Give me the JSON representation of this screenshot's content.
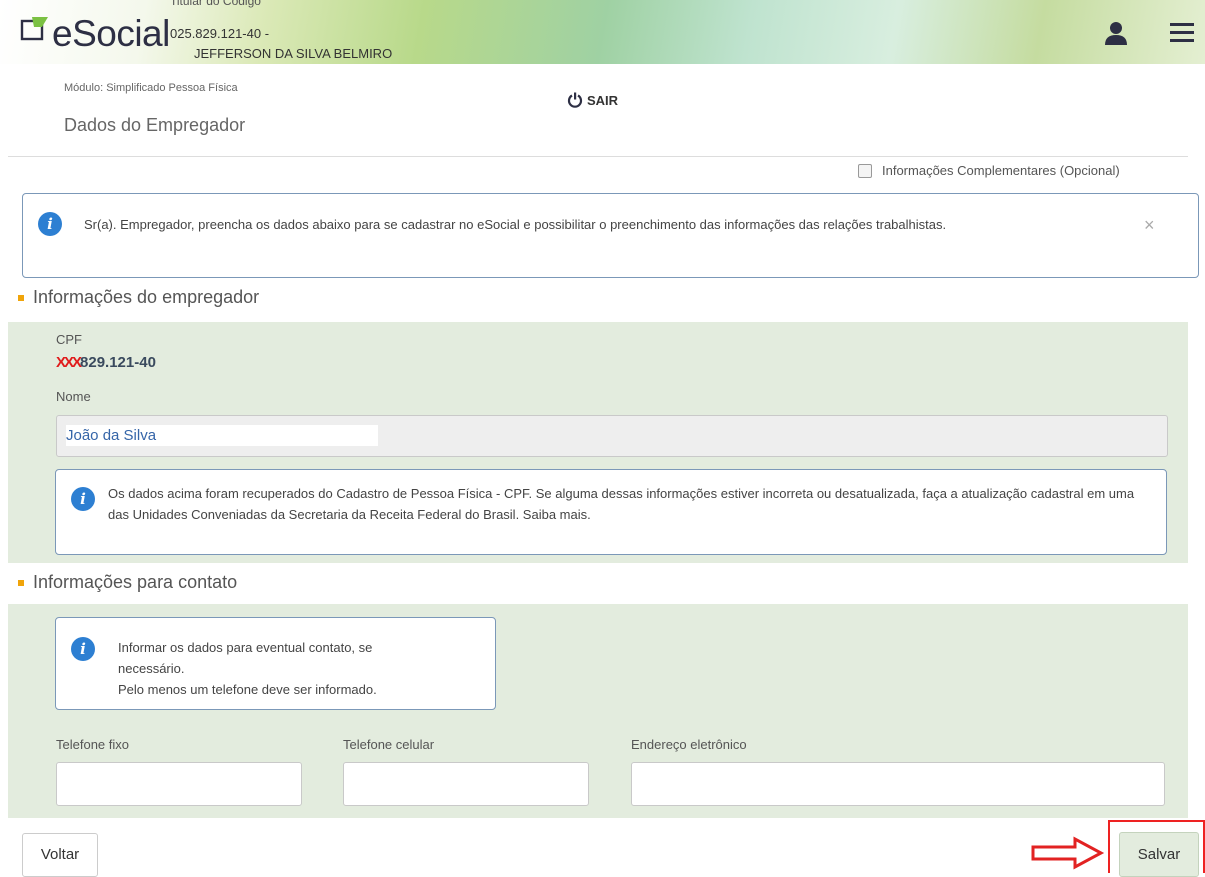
{
  "header": {
    "logo_text": "eSocial",
    "top_text": "Titular do Código",
    "cpf_line": "025.829.121-40 -",
    "name_line": "JEFFERSON DA SILVA BELMIRO",
    "icons": [
      "user-icon",
      "menu-icon"
    ]
  },
  "page": {
    "module": "Módulo: Simplificado Pessoa Física",
    "sair": "SAIR",
    "title": "Dados do Empregador",
    "complementares": "Informações Complementares (Opcional)"
  },
  "alert": {
    "text": "Sr(a). Empregador, preencha os dados abaixo para se cadastrar no eSocial e possibilitar o preenchimento das informações das relações trabalhistas.",
    "close": "×"
  },
  "empregador": {
    "section_title": "Informações do empregador",
    "cpf_label": "CPF",
    "cpf_masked": "XXX",
    "cpf_value": "829.121-40",
    "nome_label": "Nome",
    "nome_value": "João da Silva",
    "info": "Os dados acima foram recuperados do Cadastro de Pessoa Física - CPF. Se alguma dessas informações estiver incorreta ou desatualizada, faça a atualização cadastral em uma das Unidades Conveniadas da Secretaria da Receita Federal do Brasil. Saiba mais."
  },
  "contato": {
    "section_title": "Informações para contato",
    "info_line1": "Informar os dados para eventual contato, se",
    "info_line2": "necessário.",
    "info_line3": "Pelo menos um telefone deve ser informado.",
    "fields": [
      {
        "label": "Telefone fixo",
        "value": ""
      },
      {
        "label": "Telefone celular",
        "value": ""
      },
      {
        "label": "Endereço eletrônico",
        "value": ""
      }
    ]
  },
  "footer": {
    "voltar": "Voltar",
    "salvar": "Salvar"
  },
  "colors": {
    "accent_blue": "#2d7fd2",
    "section_bullet": "#f0a40a",
    "green_panel": "#e3ecde",
    "annotation_red": "#e22222"
  }
}
